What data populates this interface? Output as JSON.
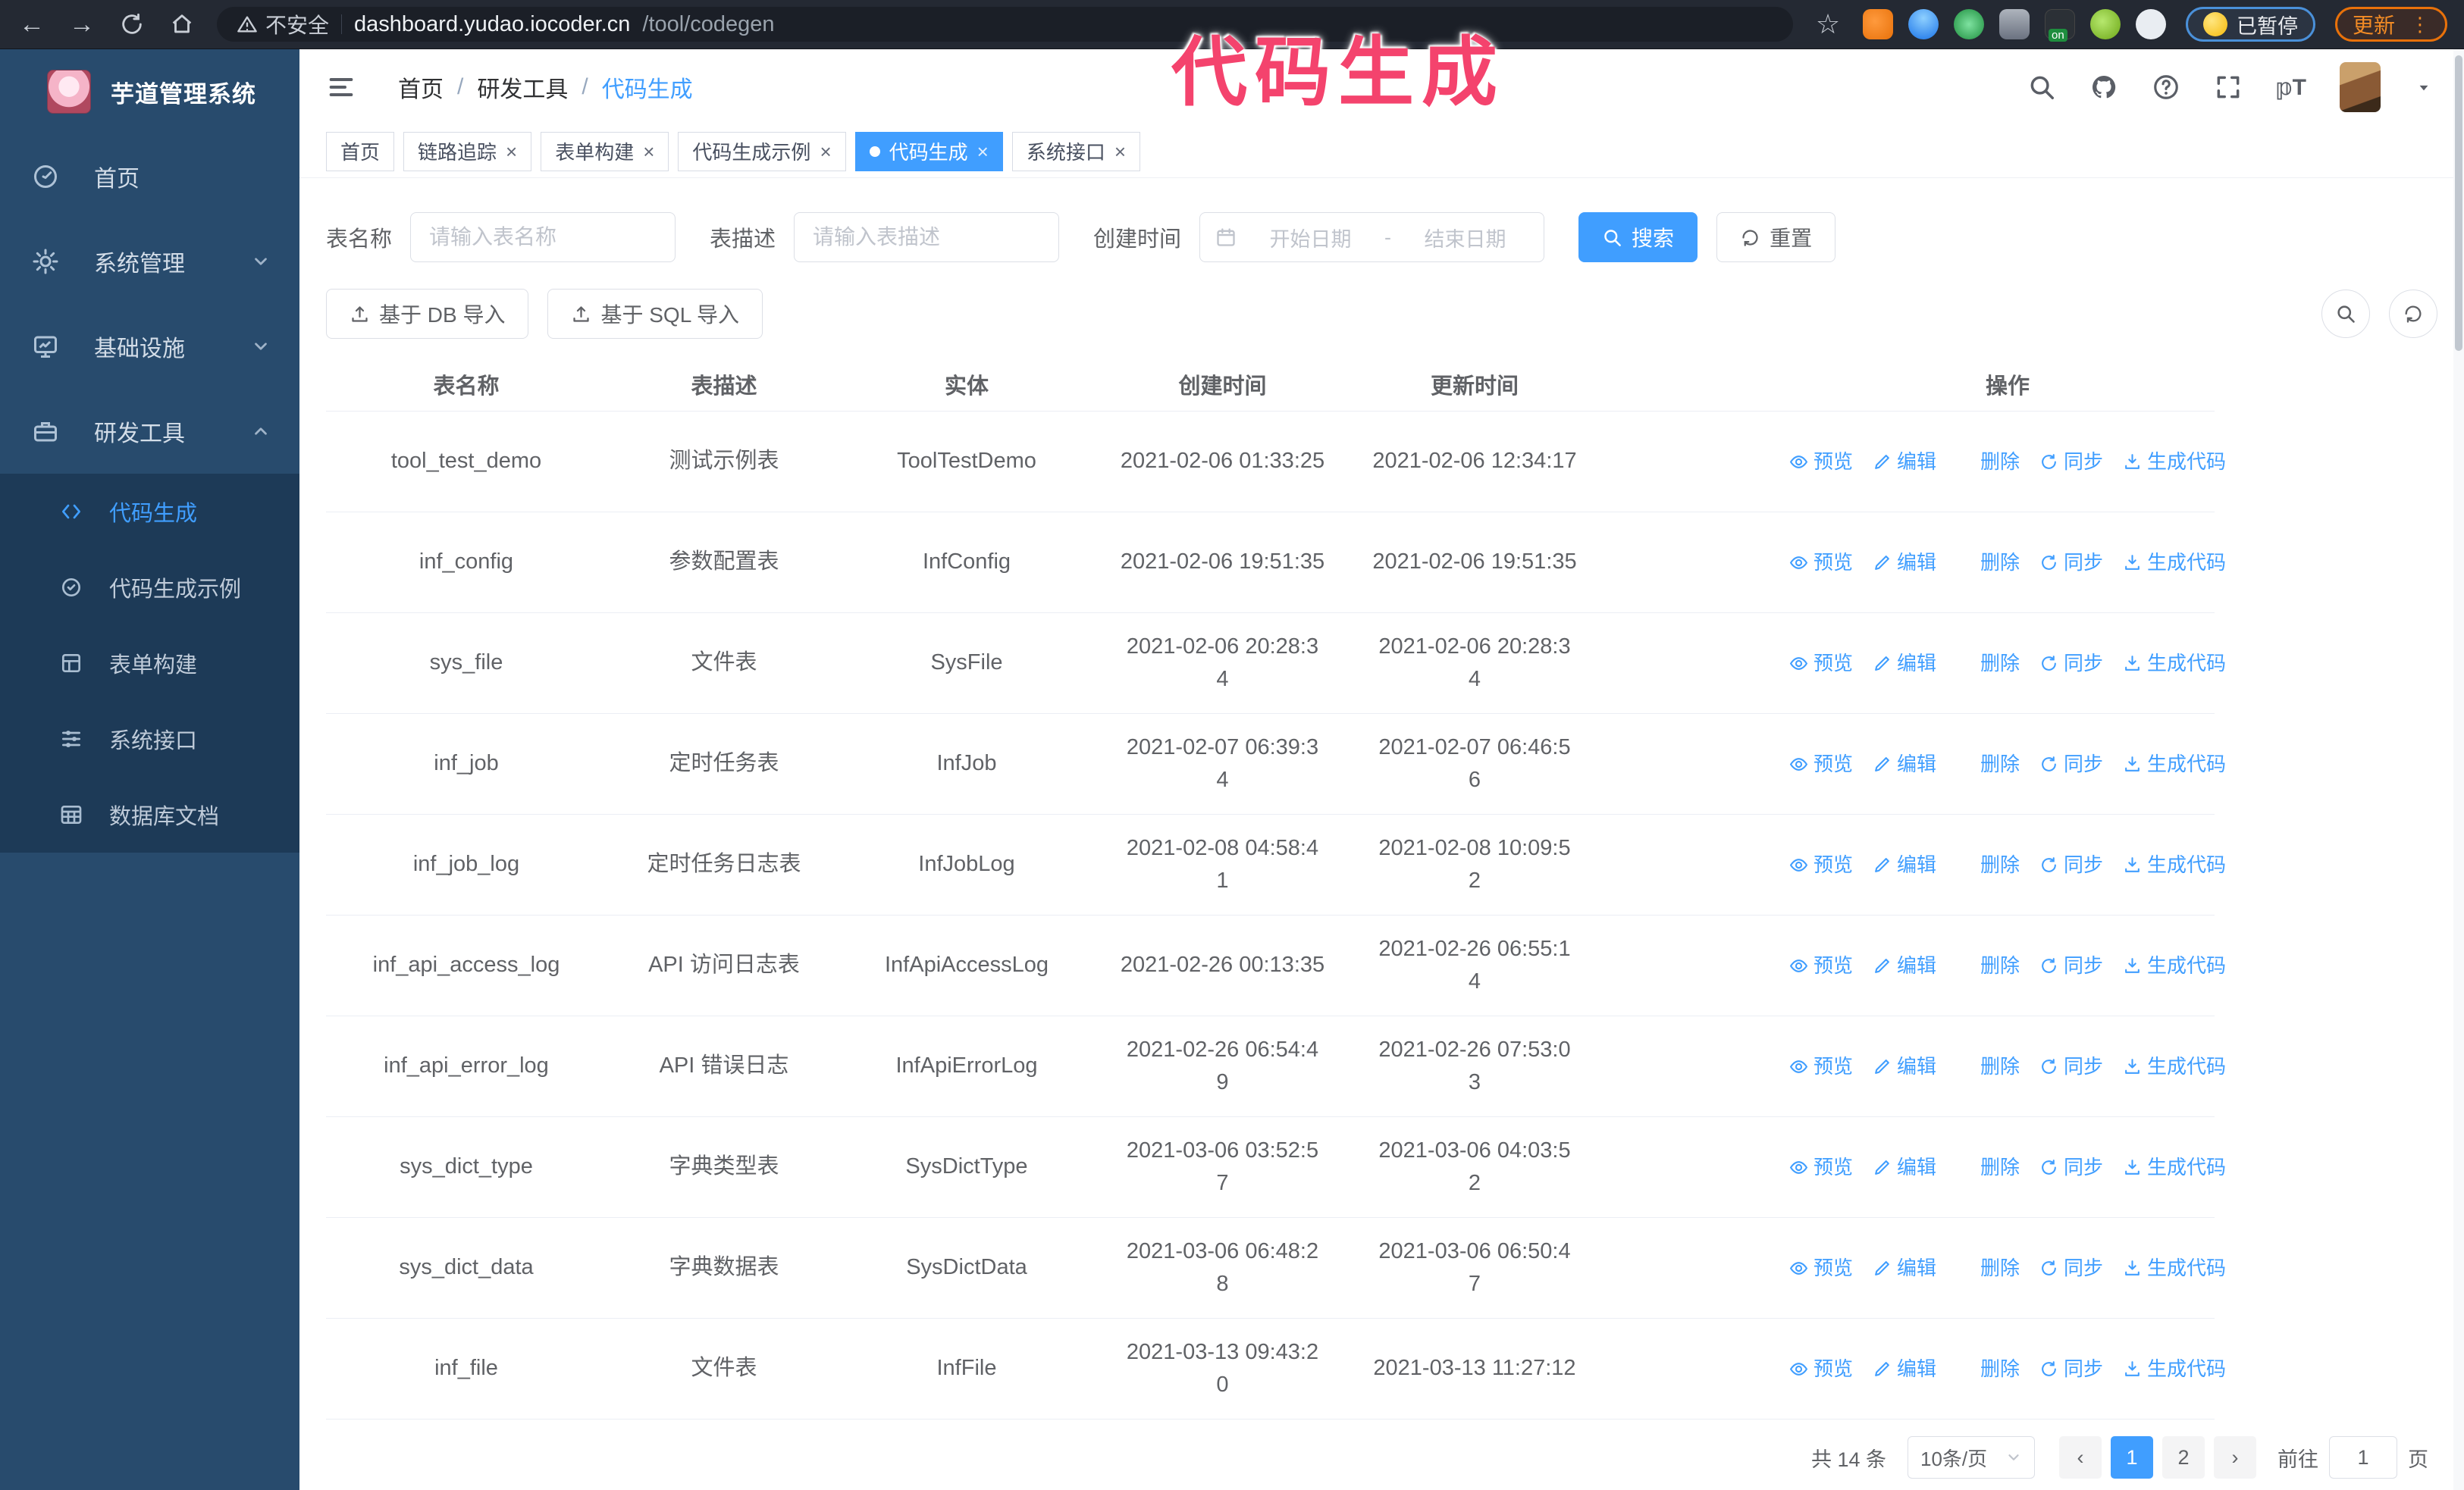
{
  "browser": {
    "security_warning": "不安全",
    "url_host": "dashboard.yudao.iocoder.cn",
    "url_path": "/tool/codegen",
    "profile_chip_label": "已暂停",
    "update_button_label": "更新"
  },
  "watermark_text": "代码生成",
  "sidebar": {
    "logo_title": "芋道管理系统",
    "menu": [
      {
        "label": "首页",
        "icon": "home-icon",
        "expandable": false,
        "expanded": false
      },
      {
        "label": "系统管理",
        "icon": "gear-icon",
        "expandable": true,
        "expanded": false
      },
      {
        "label": "基础设施",
        "icon": "infra-icon",
        "expandable": true,
        "expanded": false
      },
      {
        "label": "研发工具",
        "icon": "tool-icon",
        "expandable": true,
        "expanded": true
      }
    ],
    "submenu": [
      {
        "label": "代码生成",
        "icon": "code-icon",
        "active": true
      },
      {
        "label": "代码生成示例",
        "icon": "example-icon",
        "active": false
      },
      {
        "label": "表单构建",
        "icon": "form-icon",
        "active": false
      },
      {
        "label": "系统接口",
        "icon": "api-icon",
        "active": false
      },
      {
        "label": "数据库文档",
        "icon": "db-icon",
        "active": false
      }
    ]
  },
  "header": {
    "breadcrumb": [
      "首页",
      "研发工具",
      "代码生成"
    ]
  },
  "tabs": [
    {
      "label": "首页",
      "closable": false,
      "active": false
    },
    {
      "label": "链路追踪",
      "closable": true,
      "active": false
    },
    {
      "label": "表单构建",
      "closable": true,
      "active": false
    },
    {
      "label": "代码生成示例",
      "closable": true,
      "active": false
    },
    {
      "label": "代码生成",
      "closable": true,
      "active": true
    },
    {
      "label": "系统接口",
      "closable": true,
      "active": false
    }
  ],
  "filters": {
    "table_name_label": "表名称",
    "table_name_placeholder": "请输入表名称",
    "table_desc_label": "表描述",
    "table_desc_placeholder": "请输入表描述",
    "create_time_label": "创建时间",
    "date_start_placeholder": "开始日期",
    "date_separator": "-",
    "date_end_placeholder": "结束日期",
    "search_label": "搜索",
    "reset_label": "重置"
  },
  "toolbar": {
    "import_db_label": "基于 DB 导入",
    "import_sql_label": "基于 SQL 导入"
  },
  "table": {
    "columns": [
      "表名称",
      "表描述",
      "实体",
      "创建时间",
      "更新时间",
      "操作"
    ],
    "actions": [
      {
        "label": "预览",
        "icon": "eye-icon"
      },
      {
        "label": "编辑",
        "icon": "edit-icon"
      },
      {
        "label": "删除",
        "icon": "delete-icon"
      },
      {
        "label": "同步",
        "icon": "sync-icon"
      },
      {
        "label": "生成代码",
        "icon": "download-icon"
      }
    ],
    "rows": [
      {
        "name": "tool_test_demo",
        "desc": "测试示例表",
        "entity": "ToolTestDemo",
        "created": "2021-02-06 01:33:25",
        "updated": "2021-02-06 12:34:17"
      },
      {
        "name": "inf_config",
        "desc": "参数配置表",
        "entity": "InfConfig",
        "created": "2021-02-06 19:51:35",
        "updated": "2021-02-06 19:51:35"
      },
      {
        "name": "sys_file",
        "desc": "文件表",
        "entity": "SysFile",
        "created": "2021-02-06 20:28:3\n4",
        "updated": "2021-02-06 20:28:3\n4"
      },
      {
        "name": "inf_job",
        "desc": "定时任务表",
        "entity": "InfJob",
        "created": "2021-02-07 06:39:3\n4",
        "updated": "2021-02-07 06:46:5\n6"
      },
      {
        "name": "inf_job_log",
        "desc": "定时任务日志表",
        "entity": "InfJobLog",
        "created": "2021-02-08 04:58:4\n1",
        "updated": "2021-02-08 10:09:5\n2"
      },
      {
        "name": "inf_api_access_log",
        "desc": "API 访问日志表",
        "entity": "InfApiAccessLog",
        "created": "2021-02-26 00:13:35",
        "updated": "2021-02-26 06:55:1\n4"
      },
      {
        "name": "inf_api_error_log",
        "desc": "API 错误日志",
        "entity": "InfApiErrorLog",
        "created": "2021-02-26 06:54:4\n9",
        "updated": "2021-02-26 07:53:0\n3"
      },
      {
        "name": "sys_dict_type",
        "desc": "字典类型表",
        "entity": "SysDictType",
        "created": "2021-03-06 03:52:5\n7",
        "updated": "2021-03-06 04:03:5\n2"
      },
      {
        "name": "sys_dict_data",
        "desc": "字典数据表",
        "entity": "SysDictData",
        "created": "2021-03-06 06:48:2\n8",
        "updated": "2021-03-06 06:50:4\n7"
      },
      {
        "name": "inf_file",
        "desc": "文件表",
        "entity": "InfFile",
        "created": "2021-03-13 09:43:2\n0",
        "updated": "2021-03-13 11:27:12"
      }
    ]
  },
  "pagination": {
    "total_label": "共 14 条",
    "page_size_label": "10条/页",
    "pages": [
      "1",
      "2"
    ],
    "active_page": "1",
    "goto_label": "前往",
    "goto_value": "1",
    "goto_suffix": "页"
  }
}
